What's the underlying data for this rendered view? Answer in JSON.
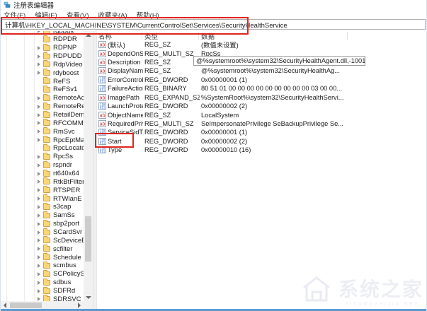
{
  "window": {
    "title": "注册表编辑器"
  },
  "menu": {
    "items": [
      "文件(F)",
      "编辑(E)",
      "查看(V)",
      "收藏夹(A)",
      "帮助(H)"
    ]
  },
  "address_bar": {
    "value": "计算机\\HKEY_LOCAL_MACHINE\\SYSTEM\\CurrentControlSet\\Services\\SecurityHealthService"
  },
  "annotations": {
    "highlight_color": "#e0241c"
  },
  "tree": {
    "items": [
      {
        "label": "rdpbus",
        "chevron": true
      },
      {
        "label": "RDPDR",
        "chevron": false
      },
      {
        "label": "RDPNP",
        "chevron": true
      },
      {
        "label": "RDPUDD",
        "chevron": true
      },
      {
        "label": "RdpVideo",
        "chevron": true
      },
      {
        "label": "rdyboost",
        "chevron": true
      },
      {
        "label": "ReFS",
        "chevron": false
      },
      {
        "label": "ReFSv1",
        "chevron": false
      },
      {
        "label": "RemoteAc",
        "chevron": true
      },
      {
        "label": "RemoteRe",
        "chevron": true
      },
      {
        "label": "RetailDem",
        "chevron": true
      },
      {
        "label": "RFCOMM",
        "chevron": true
      },
      {
        "label": "RmSvc",
        "chevron": true
      },
      {
        "label": "RpcEptMa",
        "chevron": true
      },
      {
        "label": "RpcLocato",
        "chevron": false
      },
      {
        "label": "RpcSs",
        "chevron": true
      },
      {
        "label": "rspndr",
        "chevron": true
      },
      {
        "label": "rt640x64",
        "chevron": true
      },
      {
        "label": "RtkBtFilter",
        "chevron": true
      },
      {
        "label": "RTSPER",
        "chevron": true
      },
      {
        "label": "RTWlanE",
        "chevron": true
      },
      {
        "label": "s3cap",
        "chevron": true
      },
      {
        "label": "SamSs",
        "chevron": true
      },
      {
        "label": "sbp2port",
        "chevron": true
      },
      {
        "label": "SCardSvr",
        "chevron": true
      },
      {
        "label": "ScDeviceE",
        "chevron": true
      },
      {
        "label": "scfilter",
        "chevron": true
      },
      {
        "label": "Schedule",
        "chevron": true
      },
      {
        "label": "scmbus",
        "chevron": true
      },
      {
        "label": "SCPolicyS",
        "chevron": true
      },
      {
        "label": "sdbus",
        "chevron": true
      },
      {
        "label": "SDFRd",
        "chevron": true
      },
      {
        "label": "SDRSVC",
        "chevron": true
      }
    ]
  },
  "list": {
    "columns": [
      "名称",
      "类型",
      "数据"
    ],
    "rows": [
      {
        "icon": "string",
        "name": "(默认)",
        "type": "REG_SZ",
        "data": "(数值未设置)"
      },
      {
        "icon": "string",
        "name": "DependOnSer...",
        "type": "REG_MULTI_SZ",
        "data": "RpcSs"
      },
      {
        "icon": "string",
        "name": "Description",
        "type": "REG_SZ",
        "data": "@%systemroot%\\system32\\SecurityHealthAg..."
      },
      {
        "icon": "string",
        "name": "DisplayName",
        "type": "REG_SZ",
        "data": "@%systemroot%\\system32\\SecurityHealthAg..."
      },
      {
        "icon": "dword",
        "name": "ErrorControl",
        "type": "REG_DWORD",
        "data": "0x00000001 (1)"
      },
      {
        "icon": "dword",
        "name": "FailureActions",
        "type": "REG_BINARY",
        "data": "80 51 01 00 00 00 00 00 00 00 00 00 03 00 00..."
      },
      {
        "icon": "string",
        "name": "ImagePath",
        "type": "REG_EXPAND_SZ",
        "data": "%SystemRoot%\\system32\\SecurityHealthServi..."
      },
      {
        "icon": "dword",
        "name": "LaunchProtected",
        "type": "REG_DWORD",
        "data": "0x00000002 (2)"
      },
      {
        "icon": "string",
        "name": "ObjectName",
        "type": "REG_SZ",
        "data": "LocalSystem"
      },
      {
        "icon": "string",
        "name": "RequiredPrivile...",
        "type": "REG_MULTI_SZ",
        "data": "SeImpersonatePrivilege SeBackupPrivilege Se..."
      },
      {
        "icon": "dword",
        "name": "ServiceSidType",
        "type": "REG_DWORD",
        "data": "0x00000001 (1)"
      },
      {
        "icon": "dword",
        "name": "Start",
        "type": "REG_DWORD",
        "data": "0x00000002 (2)",
        "annotated": true
      },
      {
        "icon": "dword",
        "name": "Type",
        "type": "REG_DWORD",
        "data": "0x00000010 (16)"
      }
    ]
  },
  "tooltip": {
    "text": "@%systemroot%\\system32\\SecurityHealthAgent.dll,-1001"
  },
  "watermark": {
    "title": "系统之家",
    "subtitle": "XITONGZHIJIA.NET"
  }
}
